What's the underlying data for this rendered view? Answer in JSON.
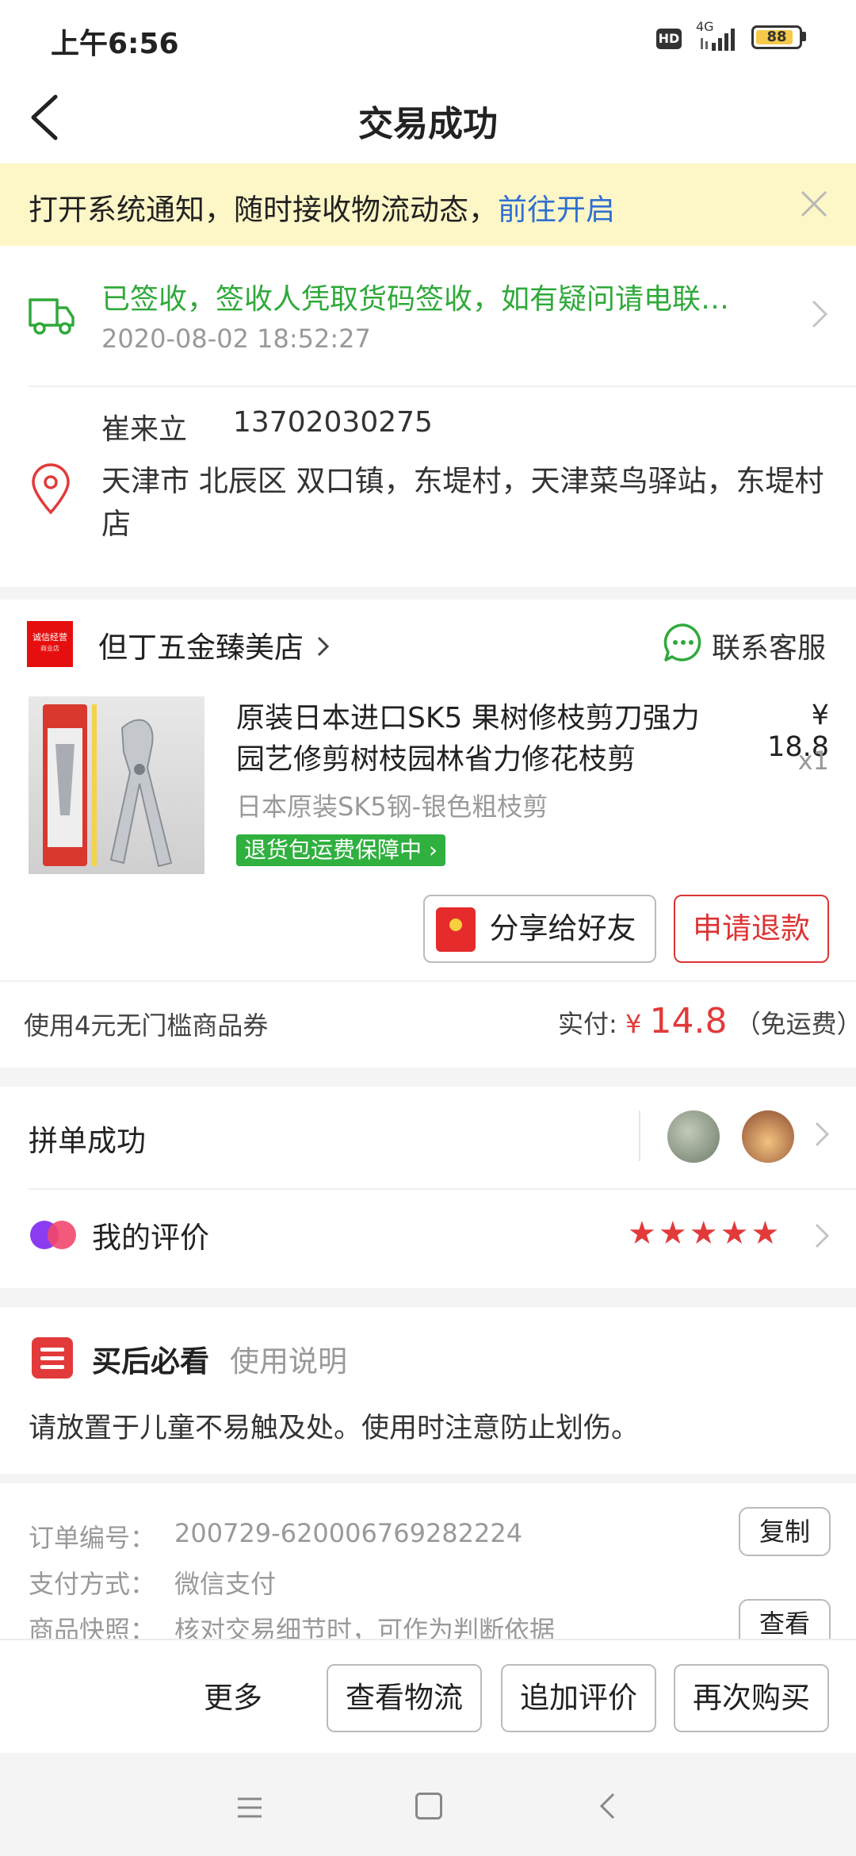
{
  "status_bar": {
    "time": "上午6:56",
    "hd": "HD",
    "network": "4G",
    "battery": "88",
    "battery_level": 0.88
  },
  "nav": {
    "title": "交易成功"
  },
  "notification": {
    "text": "打开系统通知，随时接收物流动态，",
    "link": "前往开启"
  },
  "logistics": {
    "status": "已签收，签收人凭取货码签收，如有疑问请电联…",
    "time": "2020-08-02 18:52:27"
  },
  "address": {
    "name": "崔来立",
    "phone": "13702030275",
    "detail": "天津市 北辰区 双口镇，东堤村，天津菜鸟驿站，东堤村店"
  },
  "store": {
    "badge_line1": "诚信经营",
    "badge_line2": "商业店",
    "name": "但丁五金臻美店",
    "service_label": "联系客服"
  },
  "product": {
    "title": "原装日本进口SK5 果树修枝剪刀强力园艺修剪树枝园林省力修花枝剪",
    "price": "¥ 18.8",
    "qty": "x1",
    "spec": "日本原装SK5钢-银色粗枝剪",
    "guarantee": "退货包运费保障中 ›"
  },
  "actions": {
    "share": "分享给好友",
    "refund": "申请退款"
  },
  "payment": {
    "coupon": "使用4元无门槛商品券",
    "paid_label": "实付:",
    "currency": "¥",
    "amount": "14.8",
    "shipping_note": "（免运费）"
  },
  "group": {
    "label": "拼单成功"
  },
  "review": {
    "label": "我的评价",
    "stars": "★★★★★",
    "rating": 5
  },
  "notes": {
    "title": "买后必看",
    "subtitle": "使用说明",
    "text": "请放置于儿童不易触及处。使用时注意防止划伤。"
  },
  "order_info": {
    "order_no_label": "订单编号：",
    "order_no": "200729-620006769282224",
    "payment_label": "支付方式：",
    "payment_value": "微信支付",
    "snapshot_label": "商品快照：",
    "snapshot_value": "核对交易细节时，可作为判断依据",
    "copy_label": "复制",
    "view_label": "查看"
  },
  "bottom_bar": {
    "more": "更多",
    "view_logistics": "查看物流",
    "add_review": "追加评价",
    "buy_again": "再次购买"
  },
  "colors": {
    "success_green": "#2fa93a",
    "price_red": "#e23a3a",
    "link_blue": "#2f6fd1",
    "banner_yellow": "#fdf6c7"
  }
}
